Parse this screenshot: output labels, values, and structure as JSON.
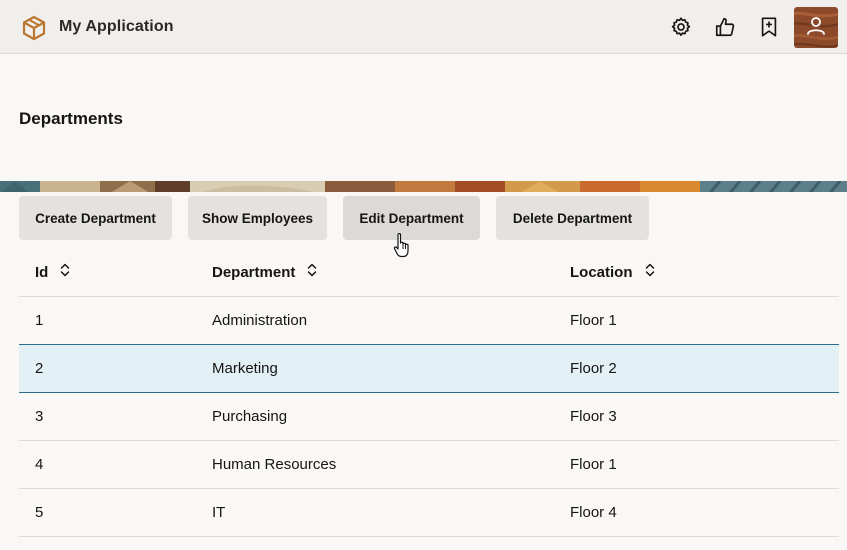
{
  "header": {
    "app_title": "My Application",
    "icons": [
      "app-logo-icon",
      "gear-icon",
      "thumbs-up-icon",
      "bookmark-plus-icon",
      "user-avatar"
    ]
  },
  "page": {
    "title": "Departments"
  },
  "toolbar": {
    "create_label": "Create Department",
    "show_label": "Show Employees",
    "edit_label": "Edit Department",
    "delete_label": "Delete Department"
  },
  "table": {
    "columns": [
      "Id",
      "Department",
      "Location"
    ],
    "rows": [
      {
        "id": "1",
        "department": "Administration",
        "location": "Floor 1"
      },
      {
        "id": "2",
        "department": "Marketing",
        "location": "Floor 2"
      },
      {
        "id": "3",
        "department": "Purchasing",
        "location": "Floor 3"
      },
      {
        "id": "4",
        "department": "Human Resources",
        "location": "Floor 1"
      },
      {
        "id": "5",
        "department": "IT",
        "location": "Floor 4"
      }
    ],
    "selected_row_id": "2"
  },
  "colors": {
    "brand_logo": "#b9772f",
    "selected_row_bg": "#e3f0f6",
    "selected_row_border": "#2b6d8a",
    "button_bg": "#e4e2df",
    "header_bg": "#f1efed"
  }
}
